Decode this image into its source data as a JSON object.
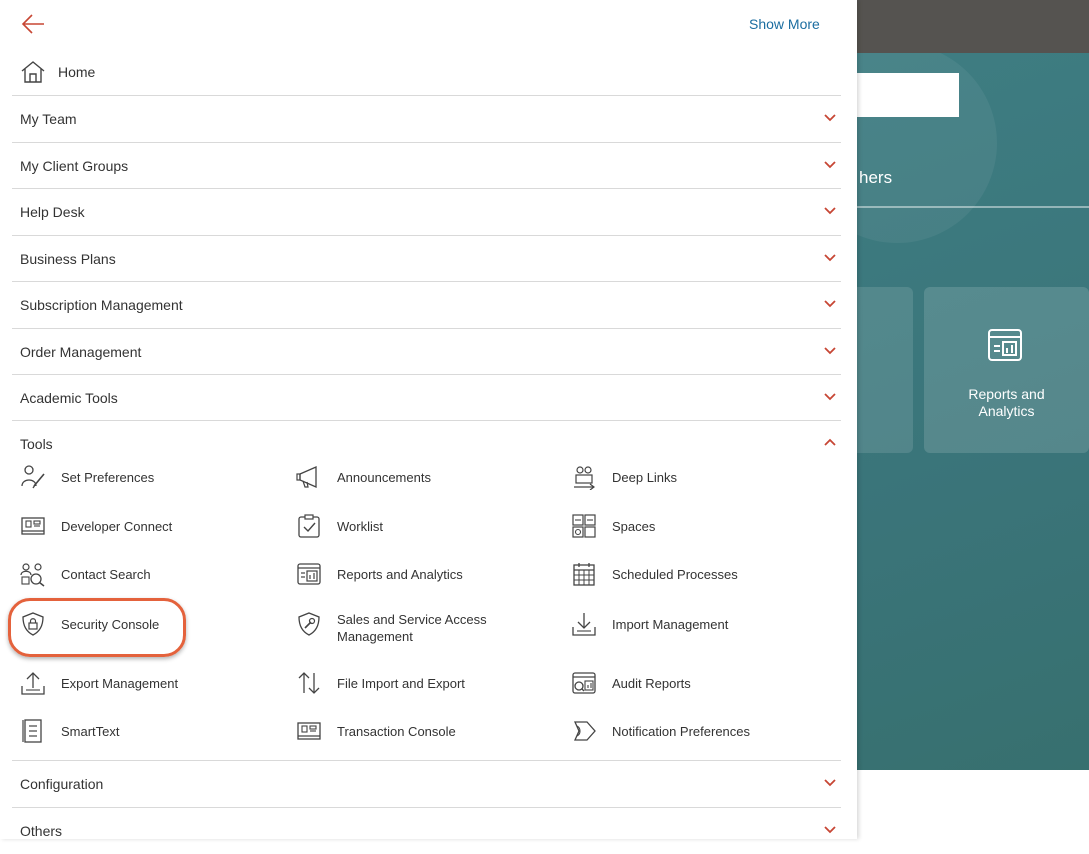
{
  "background": {
    "tab_partial": "hers",
    "card_label_line1": "Reports and",
    "card_label_line2": "Analytics"
  },
  "drawer": {
    "back_icon": "back-arrow-icon",
    "show_more": "Show More",
    "home": "Home",
    "sections": [
      {
        "label": "My Team",
        "expanded": false
      },
      {
        "label": "My Client Groups",
        "expanded": false
      },
      {
        "label": "Help Desk",
        "expanded": false
      },
      {
        "label": "Business Plans",
        "expanded": false
      },
      {
        "label": "Subscription Management",
        "expanded": false
      },
      {
        "label": "Order Management",
        "expanded": false
      },
      {
        "label": "Academic Tools",
        "expanded": false
      }
    ],
    "tools": {
      "label": "Tools",
      "expanded": true,
      "items": [
        {
          "label": "Set Preferences",
          "icon": "preferences-icon"
        },
        {
          "label": "Announcements",
          "icon": "megaphone-icon"
        },
        {
          "label": "Deep Links",
          "icon": "deep-links-icon"
        },
        {
          "label": "Developer Connect",
          "icon": "developer-connect-icon"
        },
        {
          "label": "Worklist",
          "icon": "worklist-icon"
        },
        {
          "label": "Spaces",
          "icon": "spaces-icon"
        },
        {
          "label": "Contact Search",
          "icon": "contact-search-icon"
        },
        {
          "label": "Reports and Analytics",
          "icon": "reports-icon"
        },
        {
          "label": "Scheduled Processes",
          "icon": "calendar-icon"
        },
        {
          "label": "Security Console",
          "icon": "shield-lock-icon"
        },
        {
          "label": "Sales and Service Access Management",
          "icon": "shield-wrench-icon"
        },
        {
          "label": "Import Management",
          "icon": "import-icon"
        },
        {
          "label": "Export Management",
          "icon": "export-icon"
        },
        {
          "label": "File Import and Export",
          "icon": "file-import-export-icon"
        },
        {
          "label": "Audit Reports",
          "icon": "audit-reports-icon"
        },
        {
          "label": "SmartText",
          "icon": "smarttext-icon"
        },
        {
          "label": "Transaction Console",
          "icon": "transaction-console-icon"
        },
        {
          "label": "Notification Preferences",
          "icon": "notification-icon"
        }
      ]
    },
    "bottom_sections": [
      {
        "label": "Configuration",
        "expanded": false
      },
      {
        "label": "Others",
        "expanded": false
      }
    ]
  },
  "colors": {
    "accent": "#c74634",
    "link": "#1b6da0",
    "highlight": "#e4623c",
    "teal": "#3e7d82"
  }
}
